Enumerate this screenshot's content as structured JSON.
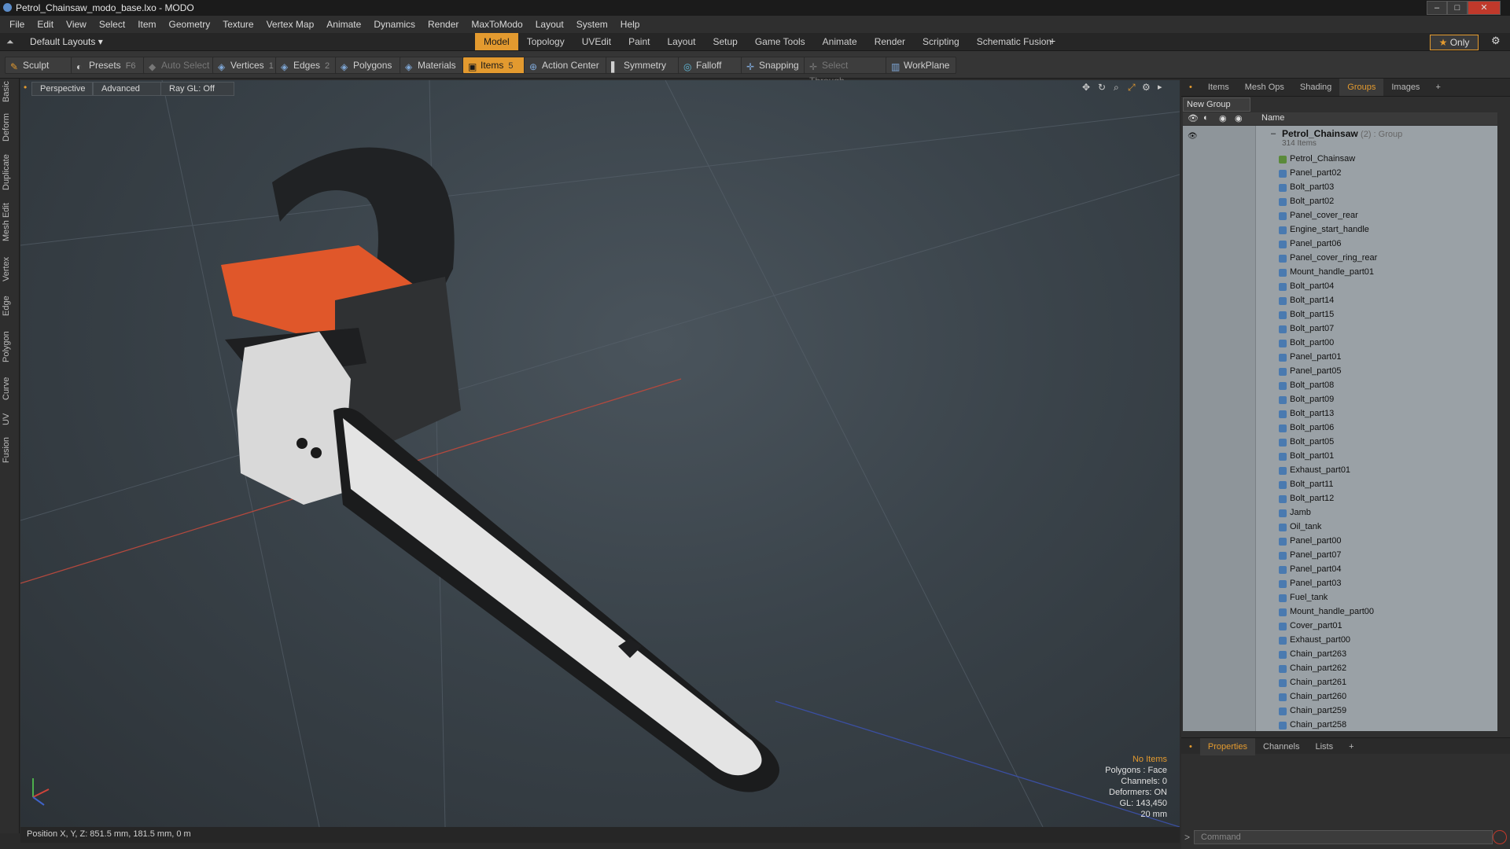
{
  "window": {
    "title": "Petrol_Chainsaw_modo_base.lxo - MODO"
  },
  "menu": [
    "File",
    "Edit",
    "View",
    "Select",
    "Item",
    "Geometry",
    "Texture",
    "Vertex Map",
    "Animate",
    "Dynamics",
    "Render",
    "MaxToModo",
    "Layout",
    "System",
    "Help"
  ],
  "layout": {
    "dropdown": "Default Layouts",
    "tabs": [
      "Model",
      "Topology",
      "UVEdit",
      "Paint",
      "Layout",
      "Setup",
      "Game Tools",
      "Animate",
      "Render",
      "Scripting",
      "Schematic Fusion"
    ],
    "active_tab": "Model",
    "only_label": "Only"
  },
  "toolbar": {
    "sculpt": "Sculpt",
    "presets": "Presets",
    "presets_shortcut": "F6",
    "auto_select": "Auto Select",
    "vertices": "Vertices",
    "vertices_count": "1",
    "edges": "Edges",
    "edges_count": "2",
    "polygons": "Polygons",
    "materials": "Materials",
    "items": "Items",
    "items_count": "5",
    "action_center": "Action Center",
    "symmetry": "Symmetry",
    "falloff": "Falloff",
    "snapping": "Snapping",
    "select_through": "Select Through",
    "workplane": "WorkPlane"
  },
  "left_tabs": [
    "Basic",
    "Deform",
    "Duplicate",
    "Mesh Edit",
    "Vertex",
    "Edge",
    "Polygon",
    "Curve",
    "UV",
    "Fusion"
  ],
  "viewport": {
    "view": "Perspective",
    "mode": "Advanced",
    "raygl": "Ray GL: Off",
    "info": {
      "items": "No Items",
      "polygons": "Polygons : Face",
      "channels": "Channels: 0",
      "deformers": "Deformers: ON",
      "gl": "GL: 143,450",
      "scale": "20 mm"
    }
  },
  "status": {
    "position": "Position X, Y, Z:  851.5 mm, 181.5 mm, 0 m"
  },
  "panel": {
    "tabs": [
      "Items",
      "Mesh Ops",
      "Shading",
      "Groups",
      "Images"
    ],
    "active_tab": "Groups",
    "new_group": "New Group",
    "col_name": "Name",
    "group": {
      "name": "Petrol_Chainsaw",
      "meta": "(2) : Group",
      "count": "314 Items"
    },
    "items": [
      "Petrol_Chainsaw",
      "Panel_part02",
      "Bolt_part03",
      "Bolt_part02",
      "Panel_cover_rear",
      "Engine_start_handle",
      "Panel_part06",
      "Panel_cover_ring_rear",
      "Mount_handle_part01",
      "Bolt_part04",
      "Bolt_part14",
      "Bolt_part15",
      "Bolt_part07",
      "Bolt_part00",
      "Panel_part01",
      "Panel_part05",
      "Bolt_part08",
      "Bolt_part09",
      "Bolt_part13",
      "Bolt_part06",
      "Bolt_part05",
      "Bolt_part01",
      "Exhaust_part01",
      "Bolt_part11",
      "Bolt_part12",
      "Jamb",
      "Oil_tank",
      "Panel_part00",
      "Panel_part07",
      "Panel_part04",
      "Panel_part03",
      "Fuel_tank",
      "Mount_handle_part00",
      "Cover_part01",
      "Exhaust_part00",
      "Chain_part263",
      "Chain_part262",
      "Chain_part261",
      "Chain_part260",
      "Chain_part259",
      "Chain_part258"
    ],
    "bottom_tabs": [
      "Properties",
      "Channels",
      "Lists"
    ],
    "bottom_active": "Properties",
    "command_placeholder": "Command"
  },
  "colors": {
    "accent": "#e39a2f",
    "list_bg": "#9aa1a6"
  }
}
